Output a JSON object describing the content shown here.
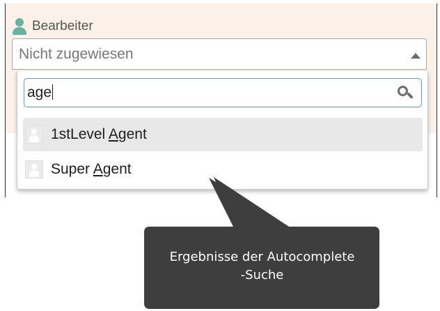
{
  "field": {
    "label": "Bearbeiter",
    "icon": "person-icon",
    "selected_value": "Nicht zugewiesen"
  },
  "search": {
    "value": "age",
    "icon": "search-icon"
  },
  "options": [
    {
      "prefix": "1stLevel ",
      "match_a": "A",
      "match_g": "g",
      "match_e": "e",
      "suffix": "nt",
      "highlighted": true
    },
    {
      "prefix": "Super ",
      "match_a": "A",
      "match_g": "g",
      "match_e": "e",
      "suffix": "nt",
      "highlighted": false
    }
  ],
  "callout": {
    "line1": "Ergebnisse der Autocomplete",
    "line2": "-Suche"
  },
  "colors": {
    "panel_bg": "#fcf1e9",
    "icon_teal": "#67b3a3",
    "search_border": "#5a9bd4",
    "highlight": "#e8e8e8",
    "callout_bg": "#3e3e3e"
  }
}
